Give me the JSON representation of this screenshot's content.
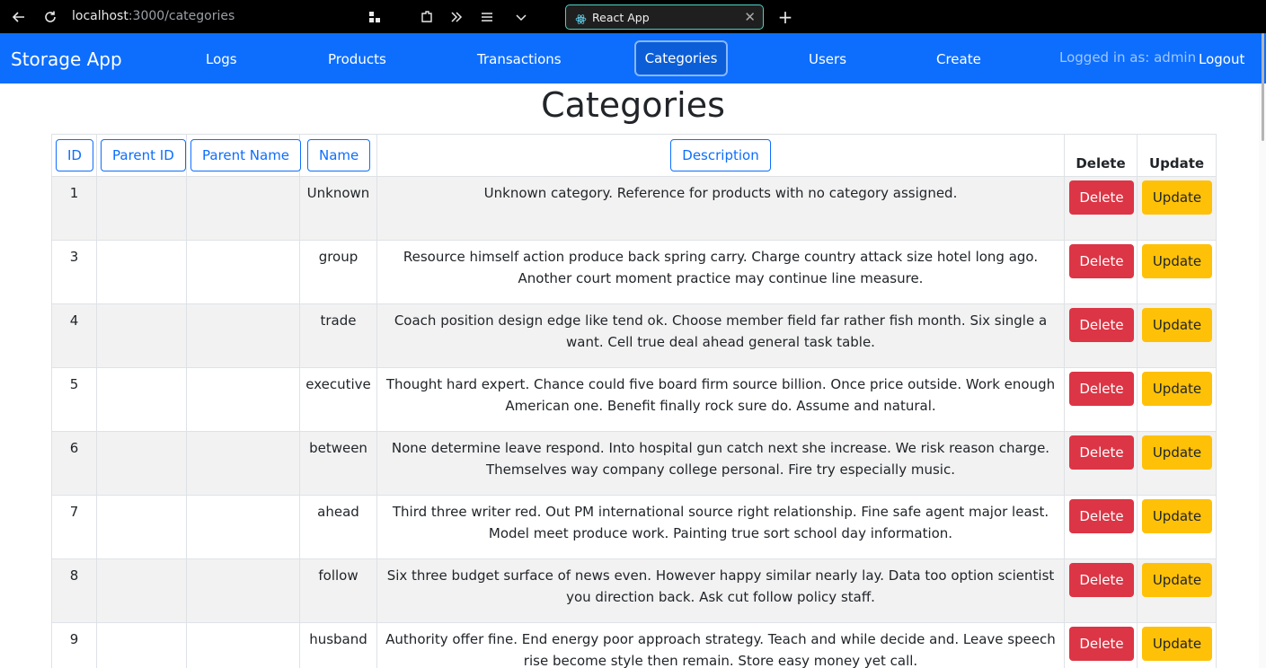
{
  "browser": {
    "url_host": "localhost",
    "url_path": ":3000/categories",
    "tab_title": "React App",
    "tab_close": "✕",
    "new_tab": "+"
  },
  "navbar": {
    "brand": "Storage App",
    "links": [
      "Logs",
      "Products",
      "Transactions",
      "Categories",
      "Users",
      "Create"
    ],
    "active": "Categories",
    "logged_in": "Logged in as: admin",
    "logout": "Logout",
    "color": "#0d6efd"
  },
  "page": {
    "title": "Categories"
  },
  "table": {
    "sort_headers": [
      "ID",
      "Parent ID",
      "Parent Name",
      "Name",
      "Description"
    ],
    "delete_header": "Delete",
    "update_header": "Update",
    "delete_label": "Delete",
    "update_label": "Update",
    "rows": [
      {
        "id": "1",
        "parent_id": "",
        "parent_name": "",
        "name": "Unknown",
        "description": "Unknown category. Reference for products with no category assigned."
      },
      {
        "id": "3",
        "parent_id": "",
        "parent_name": "",
        "name": "group",
        "description": "Resource himself action produce back spring carry. Charge country attack size hotel long ago. Another court moment practice may continue line measure."
      },
      {
        "id": "4",
        "parent_id": "",
        "parent_name": "",
        "name": "trade",
        "description": "Coach position design edge like tend ok. Choose member field far rather fish month. Six single a want. Cell true deal ahead general task table."
      },
      {
        "id": "5",
        "parent_id": "",
        "parent_name": "",
        "name": "executive",
        "description": "Thought hard expert. Chance could five board firm source billion. Once price outside. Work enough American one. Benefit finally rock sure do. Assume and natural."
      },
      {
        "id": "6",
        "parent_id": "",
        "parent_name": "",
        "name": "between",
        "description": "None determine leave respond. Into hospital gun catch next she increase. We risk reason charge. Themselves way company college personal. Fire try especially music."
      },
      {
        "id": "7",
        "parent_id": "",
        "parent_name": "",
        "name": "ahead",
        "description": "Third three writer red. Out PM international source right relationship. Fine safe agent major least. Model meet produce work. Painting true sort school day information."
      },
      {
        "id": "8",
        "parent_id": "",
        "parent_name": "",
        "name": "follow",
        "description": "Six three budget surface of news even. However happy similar nearly lay. Data too option scientist you direction back. Ask cut follow policy staff."
      },
      {
        "id": "9",
        "parent_id": "",
        "parent_name": "",
        "name": "husband",
        "description": "Authority offer fine. End energy poor approach strategy. Teach and while decide and. Leave speech rise become style then remain. Store easy money yet call."
      }
    ],
    "delete_color": "#dc3545",
    "update_color": "#ffc107"
  }
}
